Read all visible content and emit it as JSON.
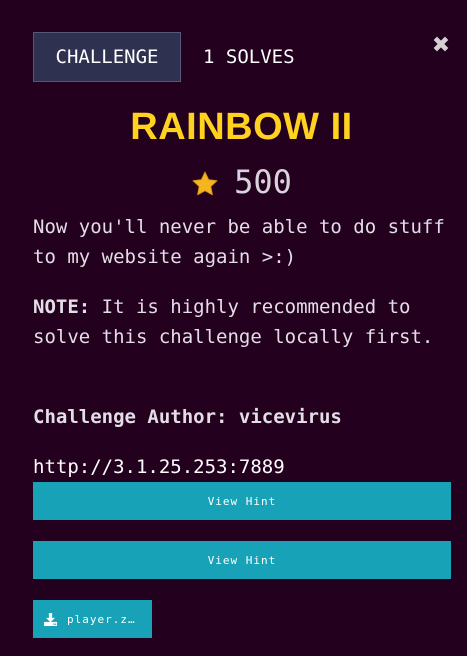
{
  "tabs": {
    "challenge_label": "CHALLENGE",
    "solves_label": "1 SOLVES"
  },
  "close_label": "✖",
  "challenge": {
    "title": "RAINBOW II",
    "points": "500",
    "description": "Now you'll never be able to do stuff to my website again >:)",
    "note_label": "NOTE:",
    "note_text": " It is highly recommended to solve this challenge locally first.",
    "author_label": "Challenge Author:",
    "author_name": "vicevirus",
    "connection_url": "http://3.1.25.253:7889"
  },
  "hints": [
    {
      "label": "View Hint"
    },
    {
      "label": "View Hint"
    }
  ],
  "files": [
    {
      "label": "player.z…",
      "icon": "download-icon"
    }
  ],
  "colors": {
    "background": "#22001e",
    "title": "#ffd21f",
    "button": "#17a2b8",
    "tab_active": "#2f3150",
    "star": "#f5b51d"
  }
}
